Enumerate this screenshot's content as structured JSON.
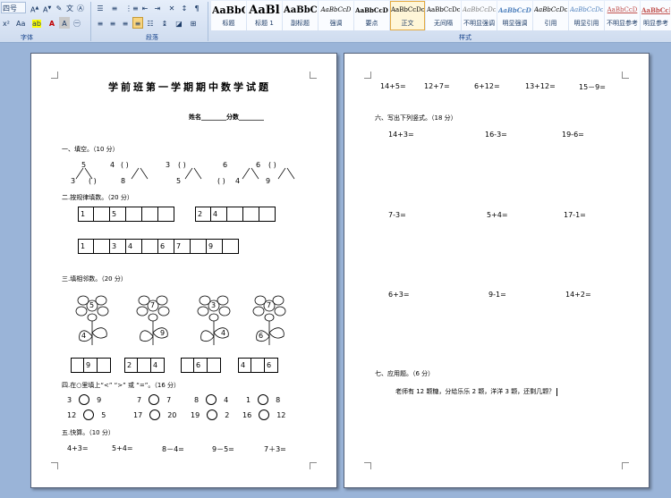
{
  "ribbon": {
    "font_size": "四号",
    "labels": {
      "font": "字体",
      "paragraph": "段落",
      "styles": "样式"
    },
    "styles": [
      {
        "sample": "AaBbC",
        "name": "标题"
      },
      {
        "sample": "AaBl",
        "name": "标题 1"
      },
      {
        "sample": "AaBbC",
        "name": "副标题"
      },
      {
        "sample": "AaBbCcD",
        "name": "强调"
      },
      {
        "sample": "AaBbCcD",
        "name": "要点"
      },
      {
        "sample": "AaBbCcDc",
        "name": "正文"
      },
      {
        "sample": "AaBbCcDc",
        "name": "无间隔"
      },
      {
        "sample": "AaBbCcDc",
        "name": "不明显强调"
      },
      {
        "sample": "AaBbCcDc",
        "name": "明显强调"
      },
      {
        "sample": "AaBbCcDc",
        "name": "引用"
      },
      {
        "sample": "AaBbCcDc",
        "name": "明显引用"
      },
      {
        "sample": "AaBbCcD",
        "name": "不明显参考"
      },
      {
        "sample": "AaBbCcD",
        "name": "明显参考"
      }
    ]
  },
  "page1": {
    "title": "学前班第一学期期中数学试题",
    "name_score": "姓名________分数________",
    "section1": "一、填空。（10 分）",
    "decompose": [
      {
        "top": "5",
        "left": "3",
        "right": "( )"
      },
      {
        "top": "4",
        "left": "( )",
        "right": "8"
      },
      {
        "top": "3",
        "left": "( )",
        "right": "5"
      },
      {
        "top": "6",
        "left": "( )",
        "right": "4"
      },
      {
        "top": "6",
        "left": "( )",
        "right": "9"
      }
    ],
    "section2": "二.按规律填数。（20 分）",
    "row_a": [
      "1",
      "",
      "5",
      "",
      "",
      ""
    ],
    "row_b": [
      "2",
      "4",
      "",
      "",
      ""
    ],
    "row_c": [
      "1",
      "",
      "3",
      "4",
      "",
      "6",
      "7",
      "",
      "9",
      ""
    ],
    "section3": "三.填相邻数。（20 分）",
    "flowers": [
      {
        "center": "5",
        "leaf": "4"
      },
      {
        "center": "7",
        "leaf": "9"
      },
      {
        "center": "3",
        "leaf": "4"
      },
      {
        "center": "7",
        "leaf": "6"
      }
    ],
    "neighbors": [
      [
        "",
        "9",
        ""
      ],
      [
        "2",
        "",
        "4"
      ],
      [
        "",
        "6",
        ""
      ],
      [
        "4",
        "",
        "6"
      ]
    ],
    "section4": "四.在○里填上“<” “>” 或 “=”。（16 分）",
    "compare": [
      [
        "3",
        "9"
      ],
      [
        "7",
        "7"
      ],
      [
        "8",
        "4"
      ],
      [
        "1",
        "8"
      ],
      [
        "12",
        "5"
      ],
      [
        "17",
        "20"
      ],
      [
        "19",
        "2"
      ],
      [
        "16",
        "12"
      ]
    ],
    "section5": "五.快算。（10 分）",
    "quick": [
      "4+3=",
      "5+4=",
      "8－4=",
      "9－5=",
      "7＋3="
    ]
  },
  "page2": {
    "top_row": [
      "14+5=",
      "12+7=",
      "6+12=",
      "13+12=",
      "15－9="
    ],
    "section6": "六、写出下列竖式。（18 分）",
    "vertical": [
      "14+3=",
      "16-3=",
      "19-6=",
      "7-3=",
      "5+4=",
      "17-1=",
      "6+3=",
      "9-1=",
      "14+2="
    ],
    "section7": "七、应用题。（6 分）",
    "word_problem": "老师有 12 颗糖，分给乐乐 2 颗，洋洋 3 颗，还剩几颗？"
  }
}
